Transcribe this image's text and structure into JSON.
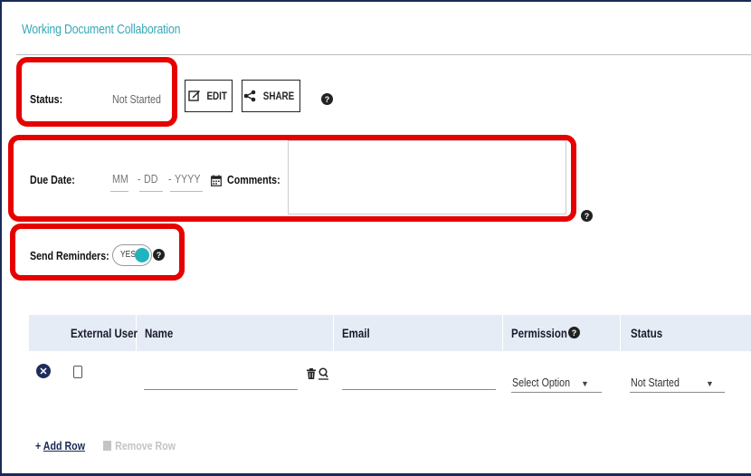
{
  "title": "Working Document Collaboration",
  "status": {
    "label": "Status:",
    "value": "Not Started"
  },
  "buttons": {
    "edit": "EDIT",
    "share": "SHARE"
  },
  "help_glyph": "?",
  "due_date": {
    "label": "Due Date:",
    "month_placeholder": "MM",
    "day_placeholder": "DD",
    "year_placeholder": "YYYY",
    "separator": "-"
  },
  "comments": {
    "label": "Comments:",
    "value": ""
  },
  "reminders": {
    "label": "Send Reminders:",
    "toggle_text": "YES",
    "enabled": true
  },
  "table": {
    "headers": {
      "external_user": "External User",
      "name": "Name",
      "email": "Email",
      "permission": "Permission",
      "status": "Status"
    },
    "rows": [
      {
        "external_user": false,
        "name": "",
        "email": "",
        "permission": "Select Option",
        "status": "Not Started"
      }
    ]
  },
  "actions": {
    "add_row": "Add Row",
    "add_prefix": "+",
    "remove_row": "Remove Row"
  },
  "colors": {
    "accent": "#37a9b5",
    "highlight": "#e60000",
    "toggle_on": "#20b4bf",
    "navy": "#1f2d5c"
  },
  "icons": {
    "edit": "edit-icon",
    "share": "share-icon",
    "help": "help-icon",
    "calendar": "calendar-icon",
    "remove": "remove-row-icon",
    "delete": "trash-icon",
    "search": "search-icon",
    "dropdown": "chevron-down-icon"
  }
}
